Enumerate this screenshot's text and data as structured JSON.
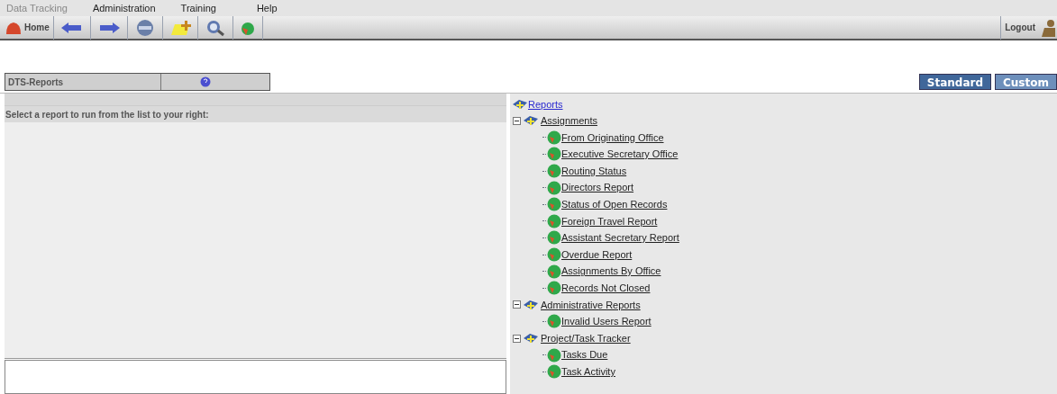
{
  "menu": [
    "Data Tracking",
    "Administration",
    "Training",
    "Help"
  ],
  "toolbar": {
    "home_label": "Home",
    "logout_label": "Logout"
  },
  "panel": {
    "title": "DTS-Reports",
    "instruction": "Select a report to run from the list to your right:"
  },
  "tabs": [
    {
      "label": "Standard",
      "selected": true
    },
    {
      "label": "Custom",
      "selected": false
    }
  ],
  "tree": {
    "label": "Reports",
    "children": [
      {
        "label": "Assignments",
        "expanded": true,
        "children": [
          {
            "label": "From Originating Office"
          },
          {
            "label": "Executive Secretary Office"
          },
          {
            "label": "Routing Status"
          },
          {
            "label": "Directors Report"
          },
          {
            "label": "Status of Open Records"
          },
          {
            "label": "Foreign Travel Report"
          },
          {
            "label": "Assistant Secretary Report"
          },
          {
            "label": "Overdue Report"
          },
          {
            "label": "Assignments By Office"
          },
          {
            "label": "Records Not Closed"
          }
        ]
      },
      {
        "label": "Administrative Reports",
        "expanded": true,
        "children": [
          {
            "label": "Invalid Users Report"
          }
        ]
      },
      {
        "label": "Project/Task Tracker",
        "expanded": true,
        "children": [
          {
            "label": "Tasks Due"
          },
          {
            "label": "Task Activity"
          }
        ]
      }
    ]
  }
}
